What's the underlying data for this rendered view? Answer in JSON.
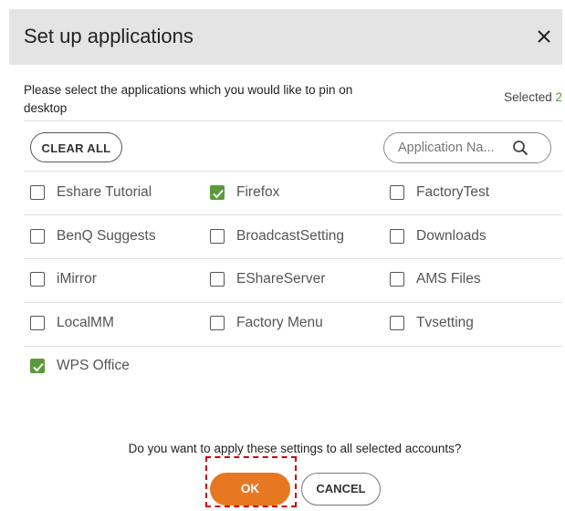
{
  "dialog": {
    "title": "Set up applications",
    "close_icon": "close-icon",
    "description": "Please select the applications which you would like to pin on desktop",
    "selected_label": "Selected",
    "selected_count": "2"
  },
  "toolbar": {
    "clear_all_label": "CLEAR ALL",
    "search_placeholder": "Application Na...",
    "search_value": "",
    "search_icon": "search-icon"
  },
  "apps": [
    {
      "label": "Eshare Tutorial",
      "checked": false
    },
    {
      "label": "Firefox",
      "checked": true
    },
    {
      "label": "FactoryTest",
      "checked": false
    },
    {
      "label": "BenQ Suggests",
      "checked": false
    },
    {
      "label": "BroadcastSetting",
      "checked": false
    },
    {
      "label": "Downloads",
      "checked": false
    },
    {
      "label": "iMirror",
      "checked": false
    },
    {
      "label": "EShareServer",
      "checked": false
    },
    {
      "label": "AMS Files",
      "checked": false
    },
    {
      "label": "LocalMM",
      "checked": false
    },
    {
      "label": "Factory Menu",
      "checked": false
    },
    {
      "label": "Tvsetting",
      "checked": false
    },
    {
      "label": "WPS Office",
      "checked": true
    }
  ],
  "footer": {
    "question": "Do you want to apply these settings to all selected accounts?",
    "ok_label": "OK",
    "cancel_label": "CANCEL"
  },
  "colors": {
    "accent_orange": "#e87722",
    "check_green": "#5b9a3b",
    "highlight_red": "#cc0000",
    "header_bg": "#e4e4e4"
  }
}
